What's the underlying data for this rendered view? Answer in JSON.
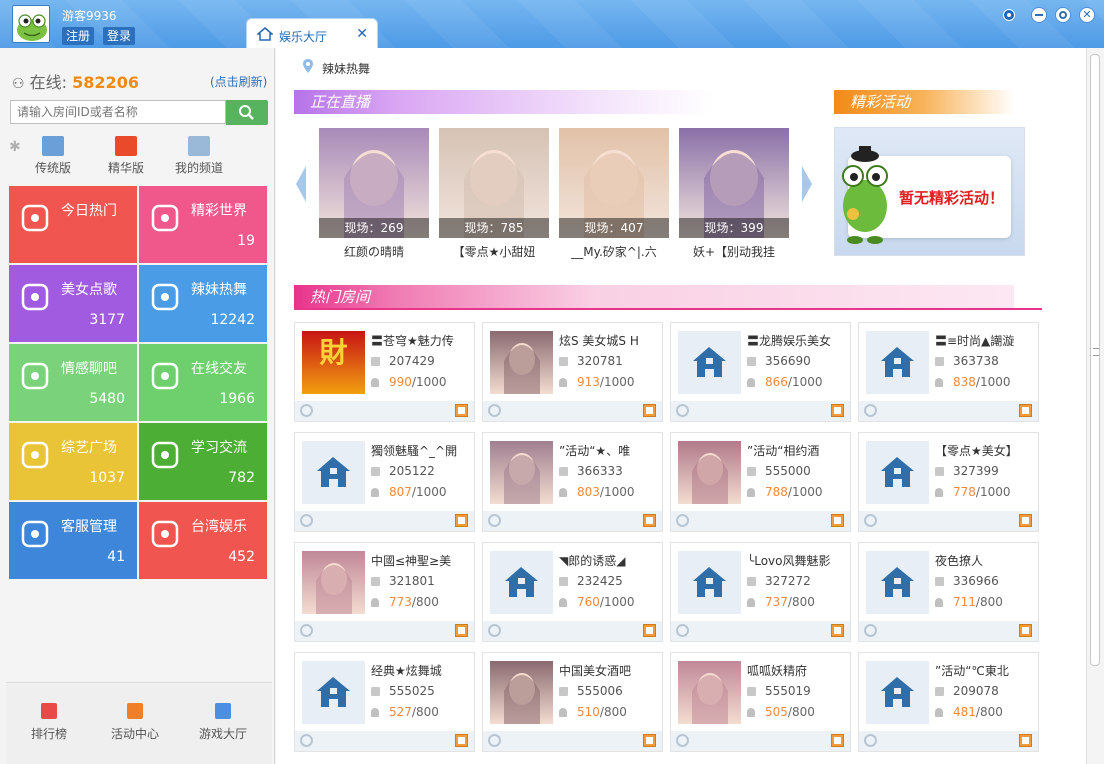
{
  "header": {
    "username": "游客9936",
    "register_label": "注册",
    "login_label": "登录",
    "tab_label": "娱乐大厅"
  },
  "sidebar": {
    "online_label": "在线:",
    "online_count": "582206",
    "refresh_label": "(点击刷新)",
    "search_placeholder": "请输入房间ID或者名称",
    "view_tabs": [
      {
        "label": "传统版",
        "icon": "monitor-icon"
      },
      {
        "label": "精华版",
        "icon": "grid-icon"
      },
      {
        "label": "我的频道",
        "icon": "person-icon"
      }
    ],
    "tiles": [
      {
        "name": "今日热门",
        "count": "",
        "color": "#f0564f",
        "icon": "flame-icon"
      },
      {
        "name": "精彩世界",
        "count": "19",
        "color": "#f0578b",
        "icon": "star-icon"
      },
      {
        "name": "美女点歌",
        "count": "3177",
        "color": "#a05be0",
        "icon": "radio-icon"
      },
      {
        "name": "辣妹热舞",
        "count": "12242",
        "color": "#4a9ce6",
        "icon": "heel-icon"
      },
      {
        "name": "情感聊吧",
        "count": "5480",
        "color": "#7ad27a",
        "icon": "chat-icon"
      },
      {
        "name": "在线交友",
        "count": "1966",
        "color": "#6dd06d",
        "icon": "friends-icon"
      },
      {
        "name": "综艺广场",
        "count": "1037",
        "color": "#e8c436",
        "icon": "tv-icon"
      },
      {
        "name": "学习交流",
        "count": "782",
        "color": "#4cae35",
        "icon": "notebook-icon"
      },
      {
        "name": "客服管理",
        "count": "41",
        "color": "#3d86d9",
        "icon": "phone-icon"
      },
      {
        "name": "台湾娱乐",
        "count": "452",
        "color": "#f0564f",
        "icon": "flame-icon"
      }
    ],
    "bottom_nav": [
      {
        "label": "排行榜",
        "icon": "ranking-icon",
        "color": "#e84a4a"
      },
      {
        "label": "活动中心",
        "icon": "flag-icon",
        "color": "#f07f2a"
      },
      {
        "label": "游戏大厅",
        "icon": "gamepad-icon",
        "color": "#4a8fe0"
      }
    ]
  },
  "main": {
    "breadcrumb": "辣妹热舞",
    "live_title": "正在直播",
    "events_title": "精彩活动",
    "events_empty": "暂无精彩活动！",
    "hot_title": "热门房间",
    "live": [
      {
        "viewers": "现场：269",
        "caption": "红颜の晴晴",
        "tone": "#a88ab8"
      },
      {
        "viewers": "现场：785",
        "caption": "【零点★小甜妞",
        "tone": "#d5c2b4"
      },
      {
        "viewers": "现场：407",
        "caption": "__My.矽家^|.六",
        "tone": "#e2c2a8"
      },
      {
        "viewers": "现场：399",
        "caption": "妖+【别动我挂",
        "tone": "#8a70a8"
      }
    ],
    "rooms": [
      {
        "title": "〓苍穹★魅力传",
        "id": "207429",
        "people": "990",
        "cap": "/1000",
        "thumb": "fortune"
      },
      {
        "title": "炫S 美女城S H",
        "id": "320781",
        "people": "913",
        "cap": "/1000",
        "thumb": "photo"
      },
      {
        "title": "〓龙腾娱乐美女",
        "id": "356690",
        "people": "866",
        "cap": "/1000",
        "thumb": "house"
      },
      {
        "title": "〓≡时尚▲謿漩",
        "id": "363738",
        "people": "838",
        "cap": "/1000",
        "thumb": "house"
      },
      {
        "title": "獨领魅騷^_^開",
        "id": "205122",
        "people": "807",
        "cap": "/1000",
        "thumb": "house"
      },
      {
        "title": "”活动“★、唯",
        "id": "366333",
        "people": "803",
        "cap": "/1000",
        "thumb": "photo"
      },
      {
        "title": "”活动“相约酒",
        "id": "555000",
        "people": "788",
        "cap": "/1000",
        "thumb": "photo"
      },
      {
        "title": "【零点★美女】",
        "id": "327399",
        "people": "778",
        "cap": "/1000",
        "thumb": "house"
      },
      {
        "title": "中國≤神聖≥美",
        "id": "321801",
        "people": "773",
        "cap": "/800",
        "thumb": "photo"
      },
      {
        "title": "◥郎的诱惑◢",
        "id": "232425",
        "people": "760",
        "cap": "/1000",
        "thumb": "house"
      },
      {
        "title": "╰Lovo风舞魅影",
        "id": "327272",
        "people": "737",
        "cap": "/800",
        "thumb": "house"
      },
      {
        "title": "夜色撩人",
        "id": "336966",
        "people": "711",
        "cap": "/800",
        "thumb": "house"
      },
      {
        "title": "经典★炫舞城",
        "id": "555025",
        "people": "527",
        "cap": "/800",
        "thumb": "house"
      },
      {
        "title": "中国美女酒吧",
        "id": "555006",
        "people": "510",
        "cap": "/800",
        "thumb": "photo"
      },
      {
        "title": "呱呱妖精府",
        "id": "555019",
        "people": "505",
        "cap": "/800",
        "thumb": "photo"
      },
      {
        "title": "”活动“℃東北",
        "id": "209078",
        "people": "481",
        "cap": "/800",
        "thumb": "house"
      }
    ]
  }
}
